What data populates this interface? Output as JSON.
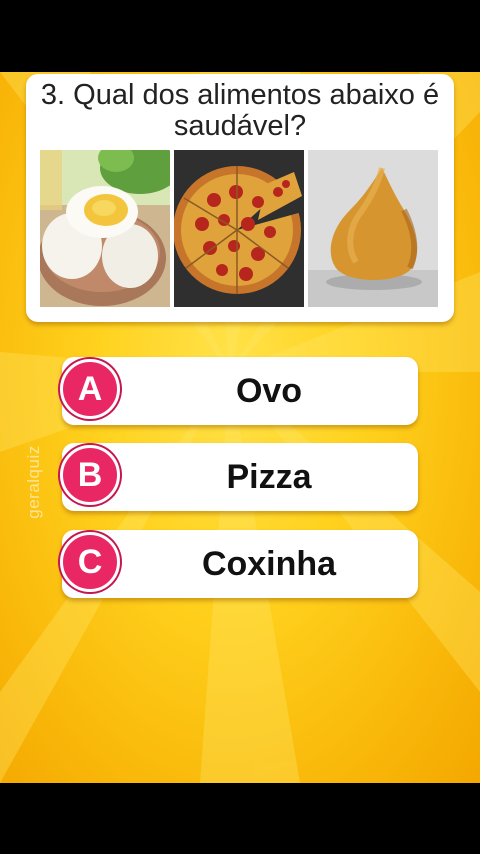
{
  "quiz": {
    "question": "3. Qual dos alimentos abaixo é saudável?",
    "images": [
      {
        "icon": "boiled-eggs-image"
      },
      {
        "icon": "pepperoni-pizza-image"
      },
      {
        "icon": "coxinha-image"
      }
    ],
    "options": [
      {
        "letter": "A",
        "label": "Ovo"
      },
      {
        "letter": "B",
        "label": "Pizza"
      },
      {
        "letter": "C",
        "label": "Coxinha"
      }
    ]
  },
  "watermark": "geralquiz",
  "colors": {
    "background": "#ffd21e",
    "badge": "#ea2765",
    "card": "#ffffff",
    "frame": "#000000"
  }
}
